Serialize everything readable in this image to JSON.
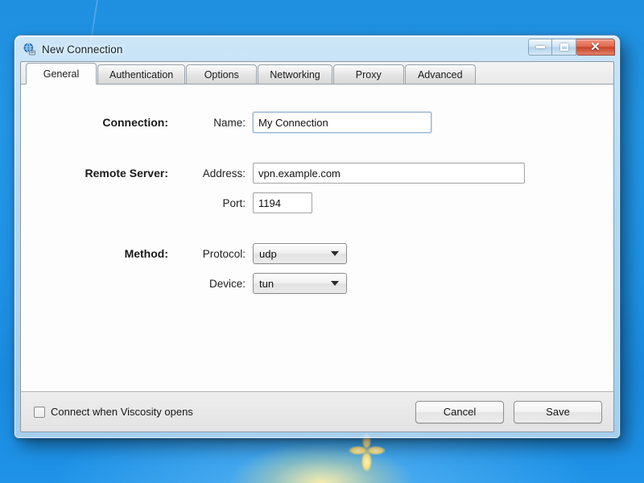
{
  "desktop": {
    "sparkle_icon": "light-burst-sparkle"
  },
  "window": {
    "title": "New Connection",
    "icon": "network-globe-icon",
    "controls": {
      "minimize": "minimize-icon",
      "maximize": "maximize-icon",
      "close": "✕"
    }
  },
  "tabs": [
    {
      "label": "General",
      "active": true
    },
    {
      "label": "Authentication",
      "active": false
    },
    {
      "label": "Options",
      "active": false
    },
    {
      "label": "Networking",
      "active": false
    },
    {
      "label": "Proxy",
      "active": false
    },
    {
      "label": "Advanced",
      "active": false
    }
  ],
  "form": {
    "connection": {
      "group_label": "Connection:",
      "name_label": "Name:",
      "name_value": "My Connection"
    },
    "remote_server": {
      "group_label": "Remote Server:",
      "address_label": "Address:",
      "address_value": "vpn.example.com",
      "port_label": "Port:",
      "port_value": "1194"
    },
    "method": {
      "group_label": "Method:",
      "protocol_label": "Protocol:",
      "protocol_value": "udp",
      "device_label": "Device:",
      "device_value": "tun"
    }
  },
  "footer": {
    "checkbox_label": "Connect when Viscosity opens",
    "checkbox_checked": false,
    "cancel_label": "Cancel",
    "save_label": "Save"
  },
  "colors": {
    "close_button": "#c9442a",
    "aero_glass": "#cbe4f6",
    "panel": "#fdfdfd",
    "footer": "#e9e9e9"
  }
}
